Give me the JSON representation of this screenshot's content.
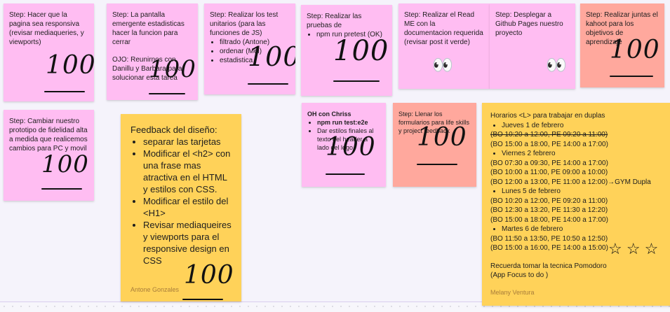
{
  "notes": {
    "n1": {
      "text": "Step: Hacer que la pagina sea responsiva (revisar mediaqueries, y viewports)",
      "mark": "100"
    },
    "n2": {
      "text": "Step: La pantalla emergente estadisticas hacer la funcion para cerrar",
      "extra": "OJO: Reunirnos con Danillu y Barbara para solucionar esta tarea",
      "mark": "100"
    },
    "n3": {
      "text": "Step: Realizar los test unitarios (para las funciones de JS)",
      "items": [
        "filtrado (Antone)",
        "ordenar (Mel)",
        "estadistica"
      ],
      "mark": "100"
    },
    "n4": {
      "text": "Step: Realizar las pruebas de",
      "items": [
        "npm run pretest (OK)"
      ],
      "mark": "100"
    },
    "n5": {
      "text": "Step: Realizar el Read ME con la documentacion requerida (revisar post it verde)",
      "emoji": "👀"
    },
    "n6": {
      "text": "Step: Desplegar a Github Pages nuestro proyecto",
      "emoji": "👀"
    },
    "n7": {
      "text": "Step: Realizar juntas el kahoot para los objetivos de aprendizaje",
      "mark": "100"
    },
    "n8": {
      "text": "Step: Cambiar nuestro prototipo de fidelidad alta a medida que realicemos cambios para PC y movil",
      "mark": "100"
    },
    "n9": {
      "title": "Feedback del diseño:",
      "items": [
        "separar las tarjetas",
        "Modificar el <h2> con una frase mas atractiva en el HTML y estilos con CSS.",
        "Modificar el estilo del <H1>",
        "Revisar mediaqueires y viewports para el responsive design en CSS"
      ],
      "author": "Antone Gonzales",
      "mark": "100"
    },
    "n10": {
      "title": "OH con Chriss",
      "items": [
        "npm run test:e2e",
        "Dar estilos finales al texto del header a lado del logo"
      ],
      "mark": "100"
    },
    "n11": {
      "text": "Step: Llenar los formularios para life skills y project feedback",
      "mark": "100"
    },
    "n12": {
      "title": "Horarios <L> para trabajar en duplas",
      "day1": "Jueves 1 de febrero",
      "day1_lines": [
        "(BO 10:20 a 12:00, PE 09:20 a 11:00)",
        "(BO 15:00 a 18:00, PE 14:00 a 17:00)"
      ],
      "day2": "Viernes 2 febrero",
      "day2_lines": [
        "(BO 07:30 a 09:30, PE 14:00 a 17:00)",
        "(BO 10:00 a 11:00, PE 09:00 a 10:00)",
        "(BO 12:00 a 13:00, PE 11:00 a 12:00)→GYM Dupla"
      ],
      "day3": "Lunes 5 de febrero",
      "day3_lines": [
        "(BO 10:20 a 12:00, PE 09:20 a 11:00)",
        "(BO 12:30 a 13:20, PE 11:30 a 12:20)",
        "(BO 15:00 a 18:00, PE 14:00 a 17:00)"
      ],
      "day4": "Martes 6 de febrero",
      "day4_lines": [
        "(BO 11:50 a 13:50, PE 10:50 a 12:50)",
        "(BO 15:00 a 16:00, PE 14:00 a 15:00)"
      ],
      "footer1": "Recuerda tomar la tecnica Pomodoro",
      "footer2": "(App Focus to do )",
      "author": "Melany Ventura",
      "stars": "☆ ☆ ☆"
    }
  }
}
